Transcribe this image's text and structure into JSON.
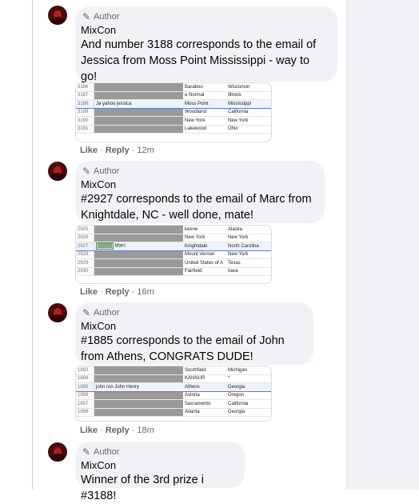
{
  "comments": [
    {
      "badge": "Author",
      "name": "MixCon",
      "text": "And number 3188 corresponds to the email of Jessica from Moss Point Mississippi - way to go!",
      "like": "Like",
      "reply": "Reply",
      "time": "12m",
      "sheet": [
        {
          "n": "3186",
          "a": "",
          "c": "Baraboo",
          "s": "Wisconsin"
        },
        {
          "n": "3187",
          "a": "",
          "c": "e Normal",
          "s": "Illinois"
        },
        {
          "n": "3188",
          "a": "Ja              yahoo jessica",
          "c": "Moss Point",
          "s": "Mississippi"
        },
        {
          "n": "3189",
          "a": "",
          "c": "Woodland",
          "s": "California"
        },
        {
          "n": "3190",
          "a": "",
          "c": "New York",
          "s": "New York"
        },
        {
          "n": "3191",
          "a": "",
          "c": "Lakewood",
          "s": "Ohio"
        }
      ]
    },
    {
      "badge": "Author",
      "name": "MixCon",
      "text": "#2927 corresponds to the email of Marc from Knightdale, NC - well done, mate!",
      "like": "Like",
      "reply": "Reply",
      "time": "16m",
      "sheet": [
        {
          "n": "2925",
          "a": "",
          "c": "keene",
          "s": "Alaska"
        },
        {
          "n": "2926",
          "a": "",
          "c": "New York",
          "s": "New York"
        },
        {
          "n": "2927",
          "a": "Marc",
          "c": "Knightdale",
          "s": "North Carolina"
        },
        {
          "n": "2928",
          "a": "",
          "c": "Mount Vernon",
          "s": "New York"
        },
        {
          "n": "2929",
          "a": "",
          "c": "United States of A",
          "s": "Texas"
        },
        {
          "n": "2930",
          "a": "",
          "c": "Fairfield",
          "s": "Iowa"
        }
      ]
    },
    {
      "badge": "Author",
      "name": "MixCon",
      "text": "#1885 corresponds to the email of John from Athens, CONGRATS DUDE!",
      "like": "Like",
      "reply": "Reply",
      "time": "18m",
      "sheet": [
        {
          "n": "1883",
          "a": "",
          "c": "Southfield",
          "s": "Michigan"
        },
        {
          "n": "1884",
          "a": "",
          "c": "KANNUR",
          "s": "*"
        },
        {
          "n": "1885",
          "a": "john             ron John Henry",
          "c": "Athens",
          "s": "Georgia"
        },
        {
          "n": "1886",
          "a": "",
          "c": "Astoria",
          "s": "Oregon"
        },
        {
          "n": "1887",
          "a": "",
          "c": "Sacramento",
          "s": "California"
        },
        {
          "n": "1888",
          "a": "",
          "c": "Atlanta",
          "s": "Georgia"
        }
      ]
    },
    {
      "badge": "Author",
      "name": "MixCon",
      "text": "Winner of the 3rd prize i #3188!"
    }
  ],
  "colors": {
    "bubble": "#f0f2f5",
    "text": "#050505",
    "meta": "#65676b",
    "highlight": "#5b7fc7"
  },
  "icons": {
    "author_badge": "pen-icon"
  }
}
